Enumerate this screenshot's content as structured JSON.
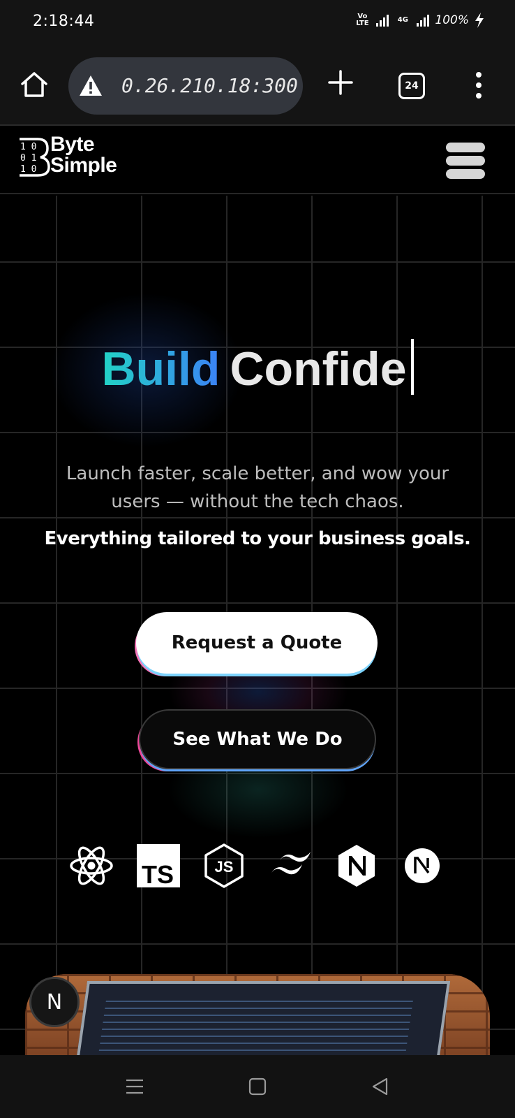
{
  "status_bar": {
    "time": "2:18:44",
    "network_badge": "VoD LTE",
    "network_type": "4G",
    "battery": "100%"
  },
  "browser": {
    "url": "0.26.210.18:300",
    "tab_count": "24",
    "icons": [
      "home-icon",
      "warning-icon",
      "plus-icon",
      "tabs-icon",
      "more-vert-icon"
    ]
  },
  "site": {
    "logo_line1": "Byte",
    "logo_line2": "Simple",
    "logo_digits": [
      "1 0",
      "0 1",
      "1 0"
    ]
  },
  "hero": {
    "headline_gradient": "Build",
    "headline_rest": "Confide",
    "subtitle": "Launch faster, scale better, and wow your users — without the tech chaos.",
    "subtitle_strong": "Everything tailored to your business goals.",
    "primary_cta": "Request a Quote",
    "secondary_cta": "See What We Do"
  },
  "tech_stack": [
    "React",
    "TS",
    "JS",
    "Tailwind",
    "NestJS",
    "Next.js"
  ],
  "preview_badge": "N",
  "colors": {
    "gradient_start": "#22d3c5",
    "gradient_end": "#3b82f6",
    "background": "#000000",
    "url_pill": "#33363d"
  }
}
